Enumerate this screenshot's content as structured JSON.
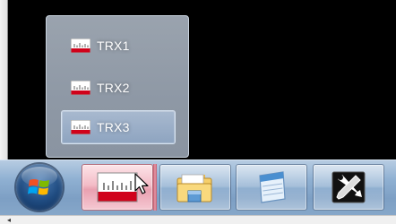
{
  "jump_list": {
    "items": [
      {
        "label": "TRX1",
        "hovered": false
      },
      {
        "label": "TRX2",
        "hovered": false
      },
      {
        "label": "TRX3",
        "hovered": true
      }
    ]
  },
  "taskbar": {
    "start_button_icon": "windows-logo-icon",
    "pinned": [
      {
        "icon": "ruler-app-icon",
        "active": true
      },
      {
        "icon": "folder-icon",
        "active": false
      },
      {
        "icon": "notepad-icon",
        "active": false
      },
      {
        "icon": "tools-icon",
        "active": false
      }
    ]
  },
  "colors": {
    "taskbar": "#8fb0d2",
    "active_button": "#f3bcc7",
    "app_icon_red": "#d0021b",
    "popup_bg": "#8e98a5"
  },
  "scrollbar": {
    "left_arrow": "◂"
  }
}
